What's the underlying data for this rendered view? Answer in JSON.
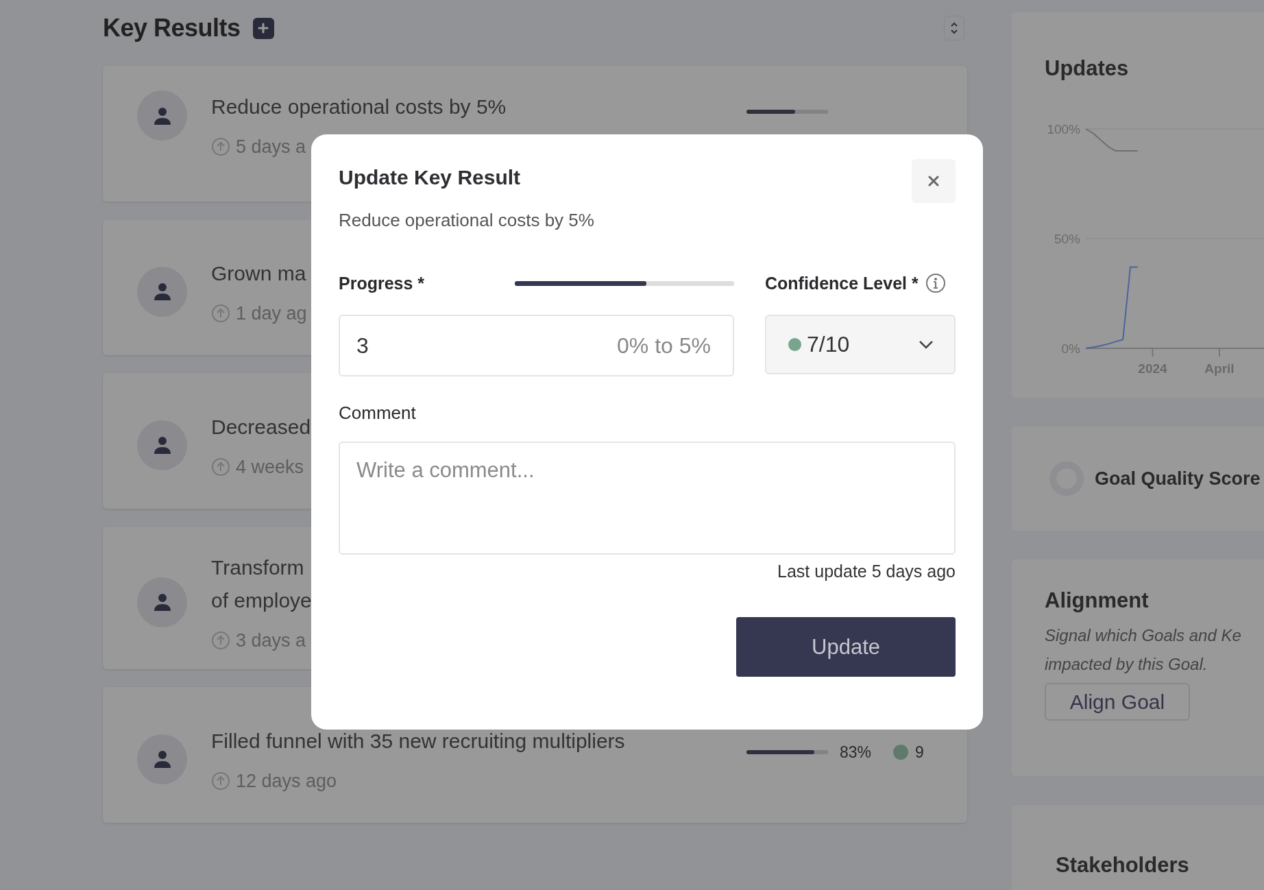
{
  "header": {
    "title": "Key Results"
  },
  "key_results": [
    {
      "title": [
        "Reduce operational costs by 5%"
      ],
      "time": "5 days a",
      "level": 0.6
    },
    {
      "title": [
        "Grown ma"
      ],
      "time": "1 day ag"
    },
    {
      "title": [
        "Decreased"
      ],
      "time": "4 weeks"
    },
    {
      "title": [
        "Transform",
        "of employe"
      ],
      "time": "3 days a"
    },
    {
      "title": [
        "Filled funnel with 35 new recruiting multipliers"
      ],
      "time": "12 days ago",
      "level": 0.83,
      "percent": "83%",
      "confidence": "9",
      "color": "#5e7a6b"
    }
  ],
  "sidebar": {
    "updates": {
      "title": "Updates",
      "chart_data": {
        "type": "line",
        "categories": [
          null,
          null,
          null,
          null,
          null,
          null,
          null,
          null,
          null,
          "2024",
          null,
          null,
          null,
          null,
          null,
          null,
          null,
          null,
          "April",
          null,
          null,
          null,
          null,
          null,
          null
        ],
        "series": [
          {
            "color": "#707070",
            "values": [
              100,
              98,
              95,
              92,
              90,
              90,
              90,
              90,
              null,
              null,
              null,
              null,
              null,
              null,
              null,
              null,
              null,
              null,
              null,
              null,
              null,
              null,
              null,
              null,
              null
            ]
          },
          {
            "color": "#4a64a0",
            "values": [
              0,
              0.5,
              1.2,
              2,
              3,
              4,
              37,
              37,
              null,
              null,
              null,
              null,
              null,
              null,
              null,
              null,
              null,
              null,
              null,
              null,
              null,
              null,
              null,
              null,
              null
            ]
          }
        ],
        "ylim": [
          0,
          100
        ],
        "yticks": [
          {
            "value": 0,
            "label": "0%"
          },
          {
            "value": 50,
            "label": "50%"
          },
          {
            "value": 100,
            "label": "100%"
          }
        ]
      }
    },
    "goal_quality": {
      "title": "Goal Quality Score"
    },
    "alignment": {
      "title": "Alignment",
      "description": [
        "Signal which Goals and Ke",
        "impacted by this Goal."
      ],
      "button": "Align Goal"
    },
    "stakeholders": {
      "title": "Stakeholders"
    }
  },
  "modal": {
    "title": "Update Key Result",
    "subtitle": "Reduce operational costs by 5%",
    "progress": {
      "label": "Progress *",
      "level": 0.6,
      "value": "3",
      "range": "0% to 5%"
    },
    "confidence": {
      "label": "Confidence Level *",
      "value": "7/10",
      "color": "#78a58c"
    },
    "comment": {
      "label": "Comment",
      "placeholder": "Write a comment..."
    },
    "last_update": "Last update 5 days ago",
    "button": {
      "label": "Update",
      "disabled": true
    }
  }
}
